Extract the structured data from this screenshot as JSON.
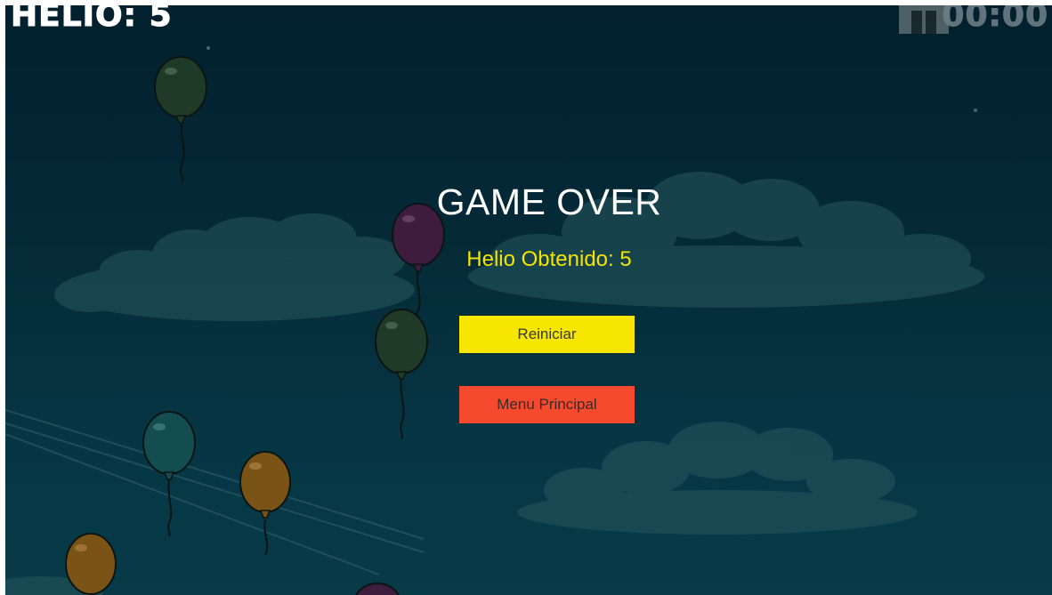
{
  "hud": {
    "helio_label": "HELIO: 5",
    "timer": "00:00"
  },
  "game_over": {
    "title": "GAME OVER",
    "score_text": "Helio Obtenido: 5",
    "restart_label": "Reiniciar",
    "menu_label": "Menu Principal"
  },
  "colors": {
    "sky_top": "#02202e",
    "sky_bottom": "#073b47",
    "title": "#ffffff",
    "score": "#f5e400",
    "restart_button": "#f7e600",
    "menu_button": "#f64a2e"
  },
  "icons": [
    "pause-icon"
  ]
}
